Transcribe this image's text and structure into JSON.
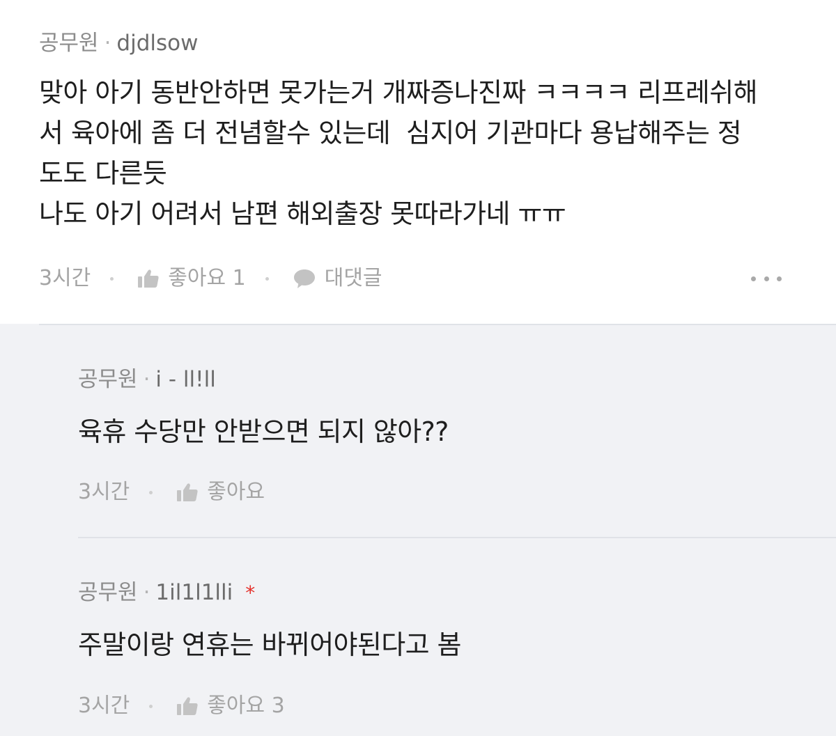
{
  "main_comment": {
    "nickname": "공무원",
    "separator": "·",
    "user_id": "djdlsow",
    "body": "맞아 아기 동반안하면 못가는거 개짜증나진짜 ㅋㅋㅋㅋ 리프레쉬해\n서 육아에 좀 더 전념할수 있는데  심지어 기관마다 용납해주는 정\n도도 다른듯\n나도 아기 어려서 남편 해외출장 못따라가네 ㅠㅠ",
    "time": "3시간",
    "like_label": "좋아요 1",
    "reply_label": "대댓글",
    "more_icon": "more-icon"
  },
  "replies": [
    {
      "nickname": "공무원",
      "separator": "·",
      "user_id": "i - ll!ll",
      "body": "육휴 수당만 안받으면 되지 않아??",
      "time": "3시간",
      "like_label": "좋아요",
      "has_star": false
    },
    {
      "nickname": "공무원",
      "separator": "·",
      "user_id": "1il1l1lli",
      "star": "*",
      "body": "주말이랑 연휴는 바뀌어야된다고 봄",
      "time": "3시간",
      "like_label": "좋아요 3",
      "has_star": true
    }
  ],
  "colors": {
    "reply_background": "#f1f2f5",
    "meta_text": "#a4a4a4",
    "star": "#e5312b"
  }
}
